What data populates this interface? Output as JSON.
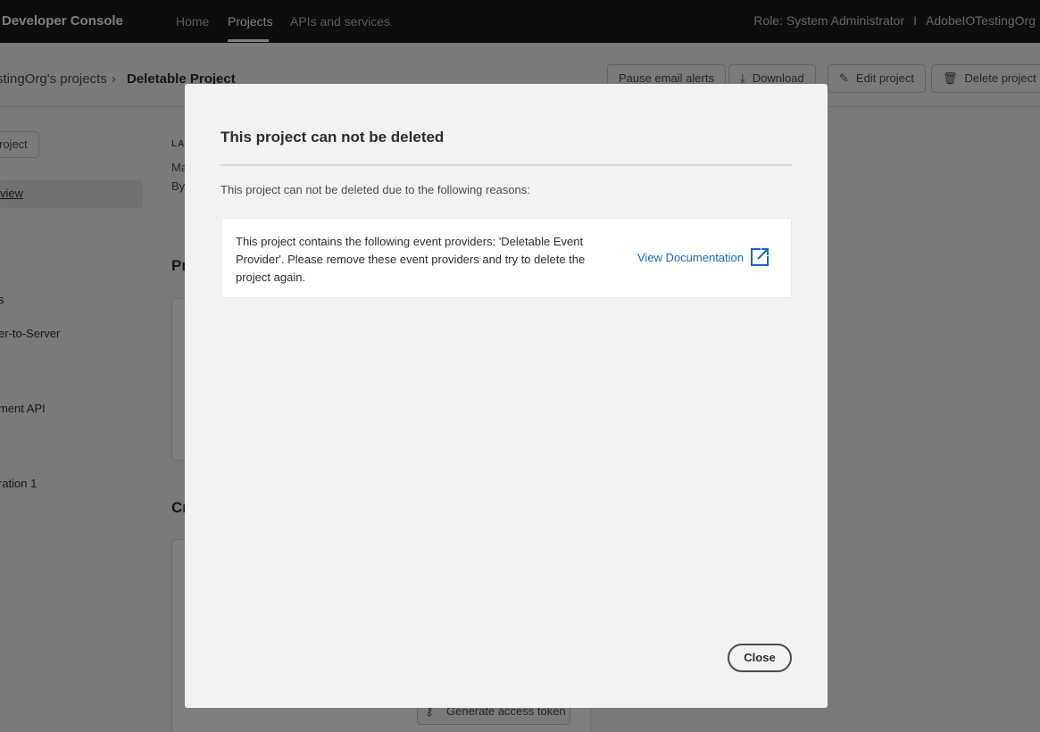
{
  "topnav": {
    "brand": "Developer Console",
    "links": [
      "Home",
      "Projects",
      "APIs and services"
    ],
    "role": "Role: System Administrator",
    "separator": "I",
    "org": "AdobeIOTestingOrg"
  },
  "header": {
    "breadcrumb_parent": "stingOrg's projects",
    "breadcrumb_chevron": "›",
    "breadcrumb_current": "Deletable Project",
    "buttons": {
      "pause": "Pause email alerts",
      "download": "Download",
      "edit": "Edit project",
      "delete": "Delete project"
    }
  },
  "sidebar": {
    "button": "roject",
    "selected": "view",
    "items": [
      "s",
      "er-to-Server",
      "ment API",
      "ration 1"
    ]
  },
  "background": {
    "last_label": "LAS",
    "meta1": "Ma",
    "meta2": "By",
    "heading1": "Pr",
    "heading2": "Cr",
    "token_button": "Generate access token"
  },
  "dialog": {
    "title": "This project can not be deleted",
    "intro": "This project can not be deleted due to the following reasons:",
    "reason": "This project contains the following event providers: 'Deletable Event Provider'. Please remove these event providers and try to delete the project again.",
    "doc_link": "View Documentation",
    "close": "Close"
  }
}
